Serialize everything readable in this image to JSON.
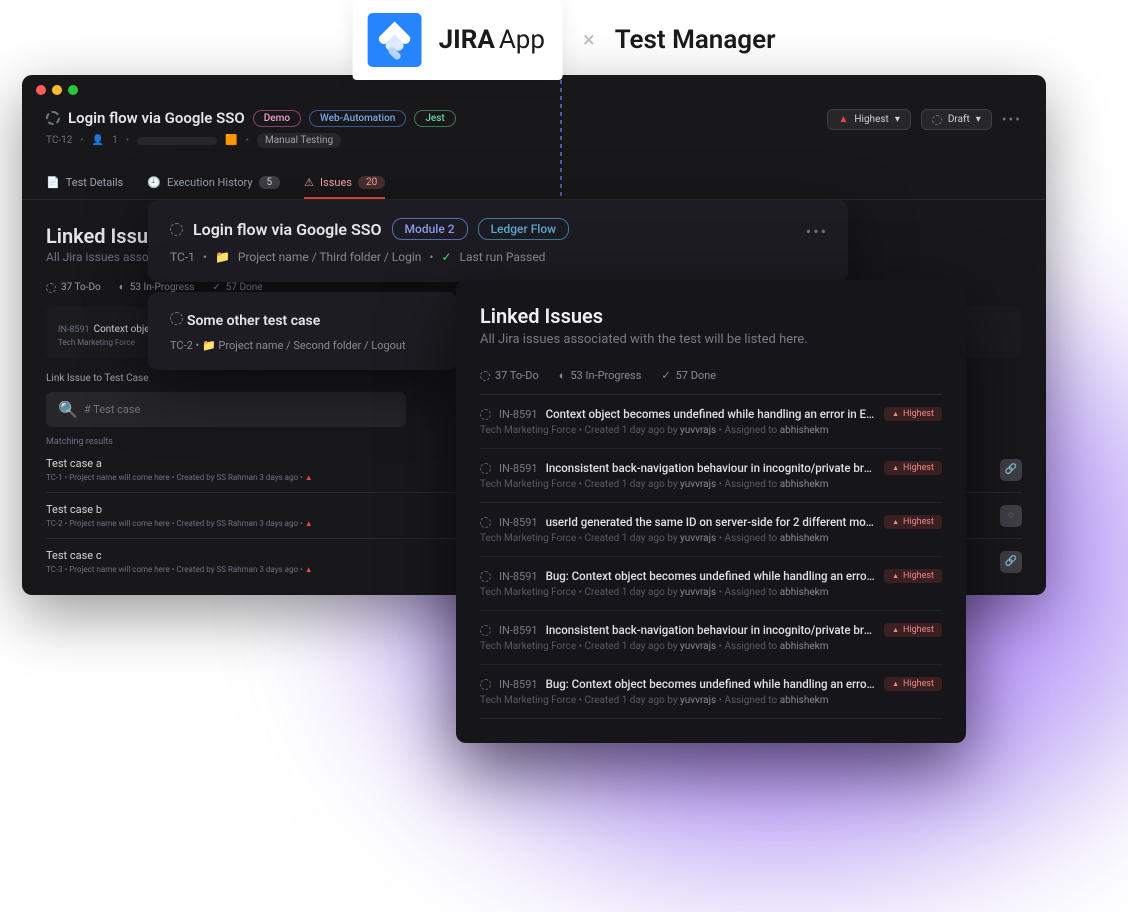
{
  "topbar": {
    "jira_label": "JIRA",
    "app_label": "App",
    "x": "×",
    "tm_label": "Test Manager"
  },
  "window": {
    "title": "Login flow via Google SSO",
    "tags": [
      "Demo",
      "Web-Automation",
      "Jest"
    ],
    "tc_id": "TC-12",
    "people_count": "1",
    "manual": "Manual Testing",
    "priority_label": "Highest",
    "draft_label": "Draft",
    "tabs": {
      "details": "Test Details",
      "history": "Execution History",
      "history_count": "5",
      "issues": "Issues",
      "issues_count": "20"
    },
    "section": {
      "title": "Linked Issues",
      "sub": "All Jira issues associated with the test will be listed here."
    },
    "stats": {
      "todo": "37 To-Do",
      "progress": "53 In-Progress",
      "done": "57 Done"
    },
    "bg_issue": {
      "id": "IN-8591",
      "title": "Context object becomes undefined while handling an error in ErrorBoundary",
      "meta_project": "Tech Marketing Force"
    },
    "link_label": "Link Issue to Test Case",
    "search_placeholder": "# Test case",
    "matching": "Matching results",
    "results": [
      {
        "name": "Test case a",
        "id": "TC-1",
        "meta": "Project name will come here  •  Created by SS Rahman 3 days ago",
        "icon": "link"
      },
      {
        "name": "Test case b",
        "id": "TC-2",
        "meta": "Project name will come here  •  Created by SS Rahman 3 days ago",
        "icon": "spinner"
      },
      {
        "name": "Test case c",
        "id": "TC-3",
        "meta": "Project name will come here  •  Created by SS Rahman 3 days ago",
        "icon": "link"
      }
    ]
  },
  "card1": {
    "title": "Login flow via Google SSO",
    "tag1": "Module 2",
    "tag2": "Ledger Flow",
    "tc": "TC-1",
    "path": "Project name / Third folder / Login",
    "status": "Last run Passed"
  },
  "card2": {
    "title": "Some other test case",
    "tc": "TC-2",
    "path": "Project name / Second folder / Logout"
  },
  "panel": {
    "title": "Linked Issues",
    "sub": "All Jira issues associated with the test will be listed here.",
    "stats": {
      "todo": "37 To-Do",
      "progress": "53 In-Progress",
      "done": "57 Done"
    },
    "issues": [
      {
        "id": "IN-8591",
        "title": "Context object becomes undefined while handling an error in ErrorBoundary",
        "priority": "Highest"
      },
      {
        "id": "IN-8591",
        "title": "Inconsistent back-navigation behaviour in incognito/private browser windows",
        "priority": "Highest"
      },
      {
        "id": "IN-8591",
        "title": "userId generated the same ID on server-side for 2 different mounted com…",
        "priority": "Highest"
      },
      {
        "id": "IN-8591",
        "title": "Bug: Context object becomes undefined while handling an error in ErrorBo…",
        "priority": "Highest"
      },
      {
        "id": "IN-8591",
        "title": "Inconsistent back-navigation behaviour in incognito/private browser macOS",
        "priority": "Highest"
      },
      {
        "id": "IN-8591",
        "title": "Bug: Context object becomes undefined while handling an error in ErrorBo…",
        "priority": "Highest"
      }
    ],
    "meta_project": "Tech Marketing Force",
    "meta_created": "Created 1 day ago by",
    "meta_author": "yuvvrajs",
    "meta_assigned_label": "Assigned to",
    "meta_assignee": "abhishekm"
  }
}
